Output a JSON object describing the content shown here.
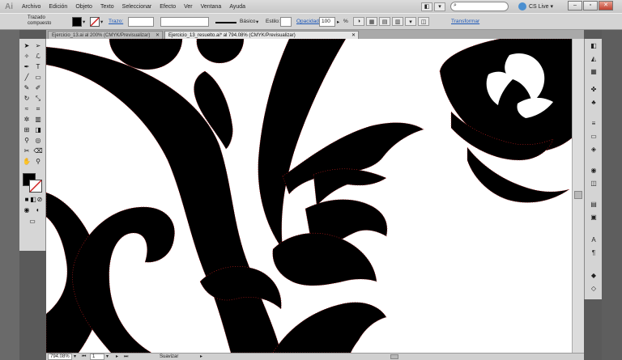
{
  "app": {
    "logo": "Ai"
  },
  "menu": [
    "Archivo",
    "Edición",
    "Objeto",
    "Texto",
    "Seleccionar",
    "Efecto",
    "Ver",
    "Ventana",
    "Ayuda"
  ],
  "search": {
    "placeholder": ""
  },
  "cslive": {
    "label": "CS Live"
  },
  "controlbar": {
    "object_type": "Trazado compuesto",
    "fill_color": "#000000",
    "stroke_label": "Trazo:",
    "stroke_value": "",
    "brush_label": "Básico",
    "style_label": "Estilo:",
    "opacity_label": "Opacidad:",
    "opacity_value": "100",
    "opacity_unit": "%",
    "transform_label": "Transformar"
  },
  "tabs": [
    {
      "label": "Ejercicio_13.ai al 200% (CMYK/Previsualizar)",
      "active": false
    },
    {
      "label": "Ejercicio_13_resuelto.ai* al 794.08% (CMYK/Previsualizar)",
      "active": true
    }
  ],
  "status": {
    "zoom": "794.08%",
    "page": "1",
    "mode": "Suavizar"
  },
  "toolbox": {
    "icons": [
      "selection-arrow",
      "direct-selection",
      "magic-wand",
      "lasso",
      "pen",
      "type",
      "line",
      "rectangle",
      "paintbrush",
      "pencil",
      "rotate",
      "scale",
      "warp",
      "free-transform",
      "symbol-sprayer",
      "graph",
      "mesh",
      "gradient",
      "eyedropper",
      "blend",
      "slice",
      "eraser",
      "hand",
      "zoom"
    ]
  },
  "colors": {
    "accent": "#1a56b8",
    "artwork": "#000000",
    "anchor": "#d02020"
  }
}
